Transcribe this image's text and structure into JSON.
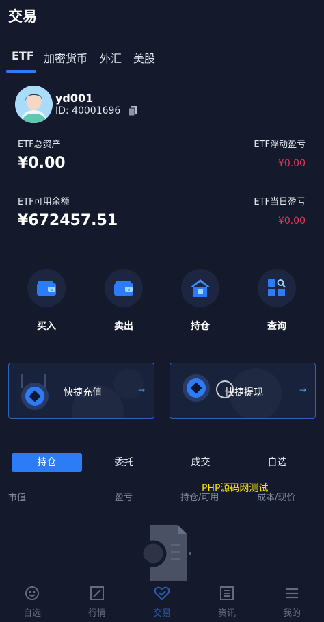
{
  "page": {
    "title": "交易"
  },
  "tabs": [
    "ETF",
    "加密货币",
    "外汇",
    "美股"
  ],
  "user": {
    "name": "yd001",
    "id": "ID: 40001696"
  },
  "stats": {
    "total_assets_label": "ETF总资产",
    "total_assets_value": "¥0.00",
    "float_pl_label": "ETF浮动盈亏",
    "float_pl_value": "¥0.00",
    "available_label": "ETF可用余额",
    "available_value": "¥672457.51",
    "daily_pl_label": "ETF当日盈亏",
    "daily_pl_value": "¥0.00"
  },
  "actions": [
    {
      "label": "买入",
      "icon": "wallet-in-icon"
    },
    {
      "label": "卖出",
      "icon": "wallet-out-icon"
    },
    {
      "label": "持仓",
      "icon": "house-icon"
    },
    {
      "label": "查询",
      "icon": "search-grid-icon"
    }
  ],
  "quick": {
    "deposit": "快捷充值",
    "withdraw": "快捷提现",
    "arrow": "→"
  },
  "subtabs": [
    "持仓",
    "委托",
    "成交",
    "自选"
  ],
  "columns": [
    "市值",
    "盈亏",
    "持仓/可用",
    "成本/现价"
  ],
  "watermark": "PHP源码网测试",
  "nav": [
    "自选",
    "行情",
    "交易",
    "资讯",
    "我的"
  ],
  "colors": {
    "accent": "#2b7cf6",
    "negative": "#e2365d",
    "background": "#141a2b"
  }
}
